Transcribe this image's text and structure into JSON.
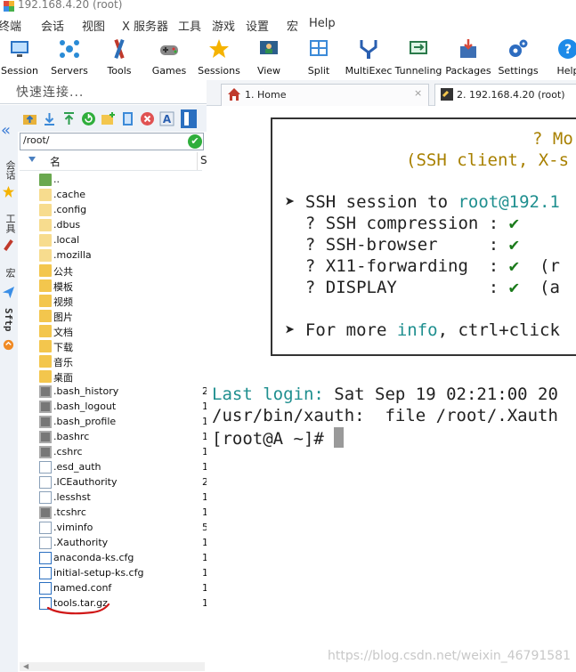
{
  "window": {
    "title": "192.168.4.20 (root)"
  },
  "menu": [
    "终端",
    "会话",
    "视图",
    "X 服务器",
    "工具",
    "游戏",
    "设置",
    "宏",
    "Help"
  ],
  "toolbar": [
    {
      "label": "Session",
      "icon": "session-icon"
    },
    {
      "label": "Servers",
      "icon": "servers-icon"
    },
    {
      "label": "Tools",
      "icon": "tools-icon"
    },
    {
      "label": "Games",
      "icon": "games-icon"
    },
    {
      "label": "Sessions",
      "icon": "star-icon"
    },
    {
      "label": "View",
      "icon": "view-icon"
    },
    {
      "label": "Split",
      "icon": "split-icon"
    },
    {
      "label": "MultiExec",
      "icon": "multiexec-icon"
    },
    {
      "label": "Tunneling",
      "icon": "tunneling-icon"
    },
    {
      "label": "Packages",
      "icon": "packages-icon"
    },
    {
      "label": "Settings",
      "icon": "settings-icon"
    },
    {
      "label": "Help",
      "icon": "help-icon"
    }
  ],
  "quick_connect": {
    "placeholder": "快速连接..."
  },
  "tabs": [
    {
      "label": "1. Home",
      "icon": "home-icon",
      "close": "×"
    },
    {
      "label": "2. 192.168.4.20 (root)",
      "icon": "terminal-tab-icon"
    }
  ],
  "side_strip": [
    "会话",
    "工具",
    "宏",
    "Sftp"
  ],
  "sftp": {
    "path": "/root/",
    "column_name": "名",
    "column_size_partial": "S",
    "files": [
      {
        "name": "..",
        "type": "up"
      },
      {
        "name": ".cache",
        "type": "dotfolder"
      },
      {
        "name": ".config",
        "type": "dotfolder"
      },
      {
        "name": ".dbus",
        "type": "dotfolder"
      },
      {
        "name": ".local",
        "type": "dotfolder"
      },
      {
        "name": ".mozilla",
        "type": "dotfolder"
      },
      {
        "name": "公共",
        "type": "folder"
      },
      {
        "name": "模板",
        "type": "folder"
      },
      {
        "name": "视频",
        "type": "folder"
      },
      {
        "name": "图片",
        "type": "folder"
      },
      {
        "name": "文档",
        "type": "folder"
      },
      {
        "name": "下载",
        "type": "folder"
      },
      {
        "name": "音乐",
        "type": "folder"
      },
      {
        "name": "桌面",
        "type": "folder"
      },
      {
        "name": ".bash_history",
        "type": "bin",
        "size": "2"
      },
      {
        "name": ".bash_logout",
        "type": "bin",
        "size": "1"
      },
      {
        "name": ".bash_profile",
        "type": "bin",
        "size": "1"
      },
      {
        "name": ".bashrc",
        "type": "bin",
        "size": "1"
      },
      {
        "name": ".cshrc",
        "type": "bin",
        "size": "1"
      },
      {
        "name": ".esd_auth",
        "type": "doc",
        "size": "1"
      },
      {
        "name": ".ICEauthority",
        "type": "doc",
        "size": "2"
      },
      {
        "name": ".lesshst",
        "type": "doc",
        "size": "1"
      },
      {
        "name": ".tcshrc",
        "type": "bin",
        "size": "1"
      },
      {
        "name": ".viminfo",
        "type": "doc",
        "size": "5"
      },
      {
        "name": ".Xauthority",
        "type": "doc",
        "size": "1"
      },
      {
        "name": "anaconda-ks.cfg",
        "type": "cfg",
        "size": "1"
      },
      {
        "name": "initial-setup-ks.cfg",
        "type": "cfg",
        "size": "1"
      },
      {
        "name": "named.conf",
        "type": "cfg",
        "size": "1"
      },
      {
        "name": "tools.tar.gz",
        "type": "archive",
        "size": "1"
      }
    ]
  },
  "terminal": {
    "banner_title": "? Mo",
    "banner_sub": "(SSH client, X-s",
    "session_prefix": "➤ SSH session to ",
    "session_host": "root@192.1",
    "rows": [
      {
        "label": "  ? SSH compression : ",
        "check": "✔",
        "extra": ""
      },
      {
        "label": "  ? SSH-browser     : ",
        "check": "✔",
        "extra": ""
      },
      {
        "label": "  ? X11-forwarding  : ",
        "check": "✔",
        "extra": "  (r"
      },
      {
        "label": "  ? DISPLAY         : ",
        "check": "✔",
        "extra": "  (a"
      }
    ],
    "more_prefix": "➤ For more ",
    "more_info": "info",
    "more_suffix": ", ctrl+click",
    "last_login_label": "Last login:",
    "last_login_value": " Sat Sep 19 02:21:00 20",
    "xauth_line": "/usr/bin/xauth:  file /root/.Xauth",
    "prompt": "[root@A ~]# "
  },
  "watermark": "https://blog.csdn.net/weixin_46791581",
  "colors": {
    "accent": "#1f8f8f",
    "check": "#1a7a1a",
    "underline": "#d01818"
  }
}
